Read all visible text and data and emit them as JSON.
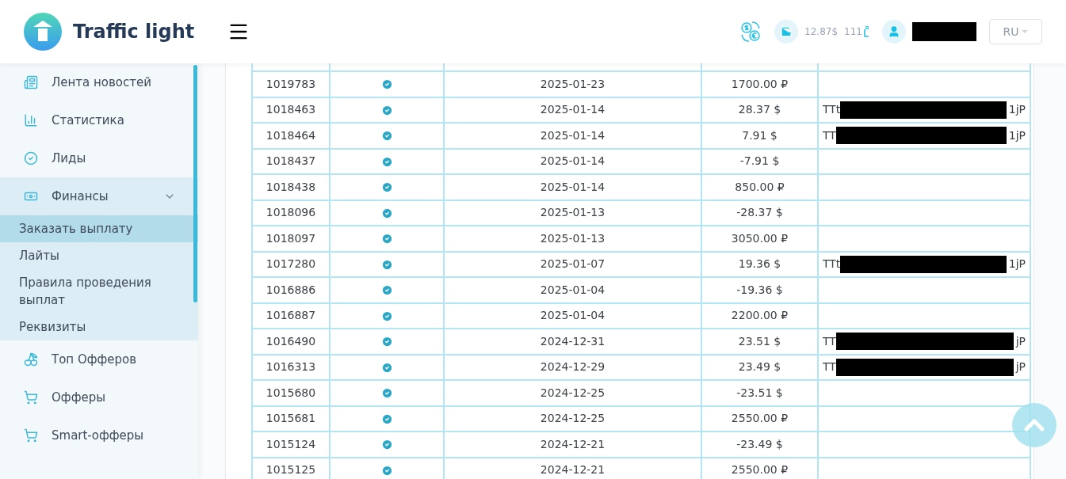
{
  "header": {
    "logo_text": "Traffic light",
    "balance_usd": "12.87$",
    "balance_lights": "111",
    "language": "RU"
  },
  "sidebar": {
    "items": [
      {
        "kind": "item",
        "label": "Лента новостей"
      },
      {
        "kind": "item",
        "label": "Статистика"
      },
      {
        "kind": "item",
        "label": "Лиды"
      },
      {
        "kind": "group",
        "label": "Финансы",
        "expanded": true,
        "children": [
          {
            "label": "Заказать выплату",
            "selected": true
          },
          {
            "label": "Лайты",
            "selected": false
          },
          {
            "label": "Правила проведения выплат",
            "selected": false
          },
          {
            "label": "Реквизиты",
            "selected": false
          }
        ]
      },
      {
        "kind": "item",
        "label": "Топ Офферов"
      },
      {
        "kind": "item",
        "label": "Офферы"
      },
      {
        "kind": "item",
        "label": "Smart-офферы"
      }
    ]
  },
  "table": {
    "rows": [
      {
        "id": "1019783",
        "paid": true,
        "date": "2025-01-23",
        "amount": "1700.00 ₽"
      },
      {
        "id": "1018463",
        "paid": true,
        "date": "2025-01-14",
        "amount": "28.37 $",
        "wallet": {
          "start": "TTt",
          "end": "1jP"
        }
      },
      {
        "id": "1018464",
        "paid": true,
        "date": "2025-01-14",
        "amount": "7.91 $",
        "wallet": {
          "start": "TT",
          "end": "1jP"
        }
      },
      {
        "id": "1018437",
        "paid": true,
        "date": "2025-01-14",
        "amount": "-7.91 $"
      },
      {
        "id": "1018438",
        "paid": true,
        "date": "2025-01-14",
        "amount": "850.00 ₽"
      },
      {
        "id": "1018096",
        "paid": true,
        "date": "2025-01-13",
        "amount": "-28.37 $"
      },
      {
        "id": "1018097",
        "paid": true,
        "date": "2025-01-13",
        "amount": "3050.00 ₽"
      },
      {
        "id": "1017280",
        "paid": true,
        "date": "2025-01-07",
        "amount": "19.36 $",
        "wallet": {
          "start": "TTt",
          "end": "1jP"
        }
      },
      {
        "id": "1016886",
        "paid": true,
        "date": "2025-01-04",
        "amount": "-19.36 $"
      },
      {
        "id": "1016887",
        "paid": true,
        "date": "2025-01-04",
        "amount": "2200.00 ₽"
      },
      {
        "id": "1016490",
        "paid": true,
        "date": "2024-12-31",
        "amount": "23.51 $",
        "wallet": {
          "start": "TT",
          "end": "jP"
        }
      },
      {
        "id": "1016313",
        "paid": true,
        "date": "2024-12-29",
        "amount": "23.49 $",
        "wallet": {
          "start": "TT",
          "end": "jP"
        }
      },
      {
        "id": "1015680",
        "paid": true,
        "date": "2024-12-25",
        "amount": "-23.51 $"
      },
      {
        "id": "1015681",
        "paid": true,
        "date": "2024-12-25",
        "amount": "2550.00 ₽"
      },
      {
        "id": "1015124",
        "paid": true,
        "date": "2024-12-21",
        "amount": "-23.49 $"
      },
      {
        "id": "1015125",
        "paid": true,
        "date": "2024-12-21",
        "amount": "2550.00 ₽"
      }
    ]
  }
}
